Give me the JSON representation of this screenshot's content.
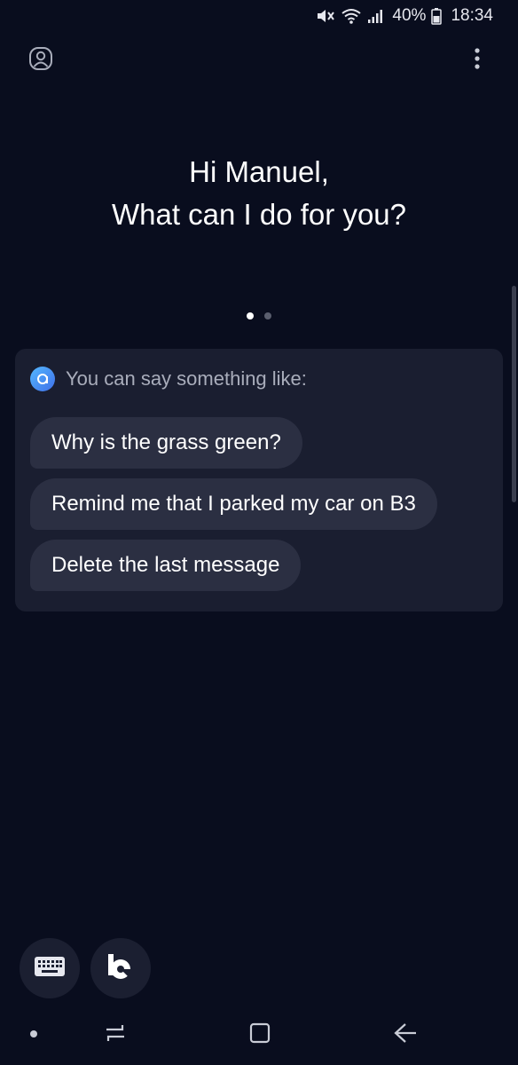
{
  "status_bar": {
    "battery_percent": "40%",
    "time": "18:34"
  },
  "top_bar": {
    "profile_icon": "user-circle-icon",
    "more_icon": "more-vertical-icon"
  },
  "greeting": {
    "line1": "Hi Manuel,",
    "line2": "What can I do for you?"
  },
  "pager": {
    "pages": 2,
    "active_page": 1
  },
  "suggestions": {
    "header": "You can say something like:",
    "items": [
      "Why is the grass green?",
      "Remind me that I parked my car on B3",
      "Delete the last message"
    ]
  },
  "bottom_buttons": {
    "keyboard_icon": "keyboard-icon",
    "bixby_icon": "bixby-icon"
  },
  "nav_bar": {
    "icons": [
      "dot-icon",
      "recents-icon",
      "home-icon",
      "back-icon"
    ]
  },
  "colors": {
    "background": "#090d1e",
    "card": "#1a1e30",
    "chip": "#2b2f42",
    "accent": "#4a8df0"
  }
}
